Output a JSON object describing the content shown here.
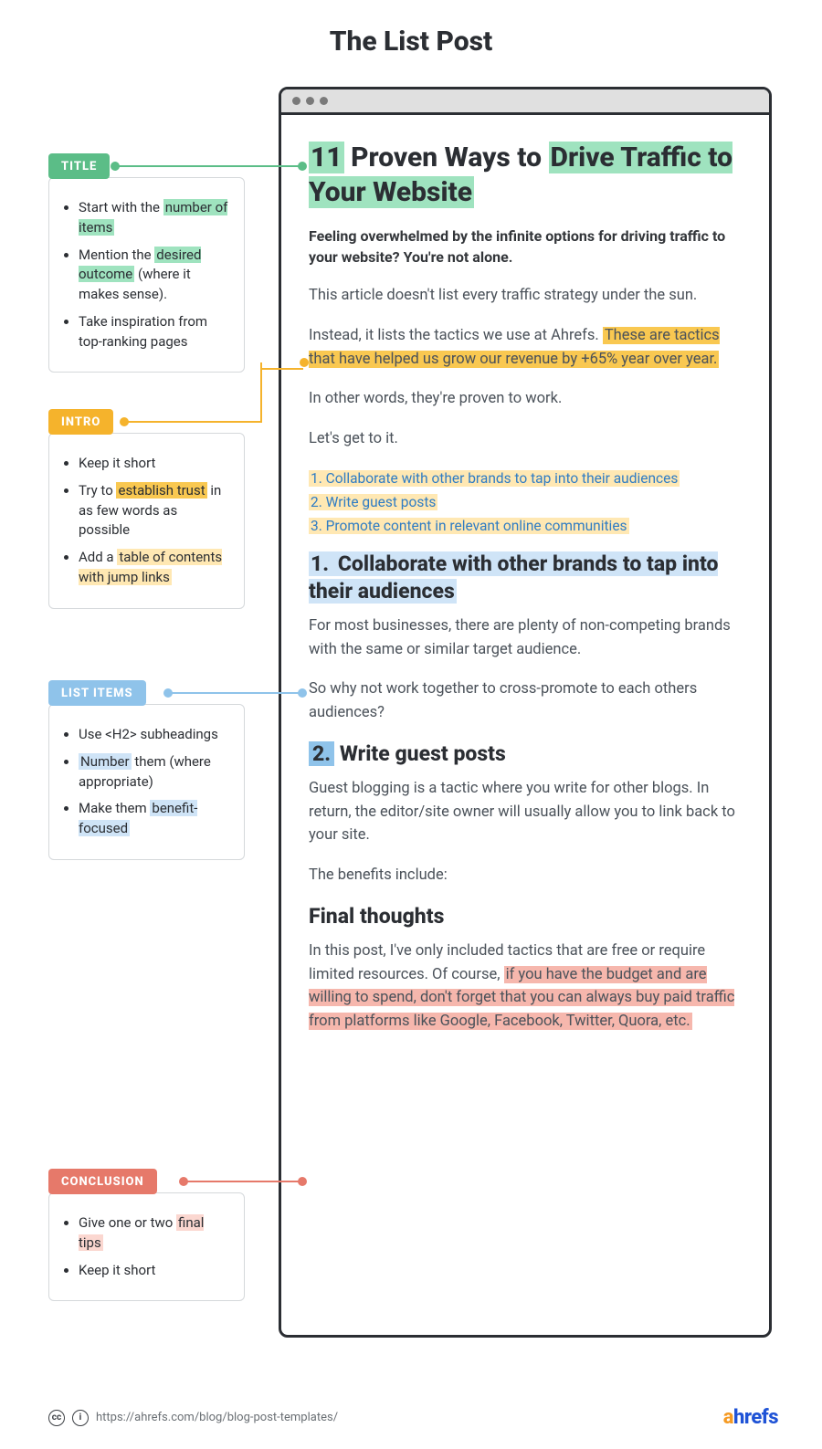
{
  "page_title": "The List Post",
  "article": {
    "title_parts": {
      "num": "11",
      "mid": " Proven Ways to ",
      "end": "Drive Traffic to Your Website"
    },
    "intro_strong": "Feeling overwhelmed by the infinite options for driving traffic to your website? You're not alone.",
    "p1": "This article doesn't list every traffic strategy under the sun.",
    "p2a": "Instead, it lists the tactics we use at Ahrefs.",
    "p2b": " These are tactics that have helped us grow our revenue by +65% year over year.",
    "p3": "In other words, they're proven to work.",
    "p4": "Let's get to it.",
    "toc": [
      "1. Collaborate with other brands to tap into their audiences",
      "2. Write guest posts",
      "3. Promote content in relevant online communities"
    ],
    "h2_1_num": "1.",
    "h2_1_txt": "  Collaborate with other brands to tap into their audiences",
    "sec1_p1": "For most businesses, there are plenty of non-competing brands with the same or similar target audience.",
    "sec1_p2": "So why not work together to cross-promote to each others audiences?",
    "h2_2_num": "2.",
    "h2_2_txt": "  Write guest posts",
    "sec2_p1": "Guest blogging is a tactic where you write for other blogs. In return, the editor/site owner will usually allow you to link back to your site.",
    "sec2_p2": "The benefits include:",
    "final_h": "Final thoughts",
    "final_a": "In this post, I've only included tactics that are free or require limited resources. Of course,",
    "final_b": " if you have the budget and are willing to spend, don't forget that you can always buy paid traffic from platforms like Google, Facebook, Twitter, Quora, etc."
  },
  "side": {
    "title": {
      "tag": "TITLE",
      "items_simple": [
        "Take inspiration from top-ranking pages"
      ],
      "i1a": "Start with the ",
      "i1b": "number of items",
      "i2a": "Mention the ",
      "i2b": "desired outcome",
      "i2c": " (where it makes sense)."
    },
    "intro": {
      "tag": "INTRO",
      "items_simple": [
        "Keep it short"
      ],
      "i2a": "Try to ",
      "i2b": "establish trust",
      "i2c": " in as few words as possible",
      "i3a": "Add a ",
      "i3b": "table of contents with jump links"
    },
    "list": {
      "tag": "LIST ITEMS",
      "i1": "Use <H2> subheadings",
      "i2a": "",
      "i2b": "Number",
      "i2c": " them (where appropriate)",
      "i3a": "Make them ",
      "i3b": "benefit-focused"
    },
    "concl": {
      "tag": "CONCLUSION",
      "items_simple": [
        "Keep it short"
      ],
      "i1a": "Give one or two ",
      "i1b": "final tips"
    }
  },
  "footer": {
    "url": "https://ahrefs.com/blog/blog-post-templates/",
    "brand_a": "a",
    "brand_rest": "hrefs"
  }
}
